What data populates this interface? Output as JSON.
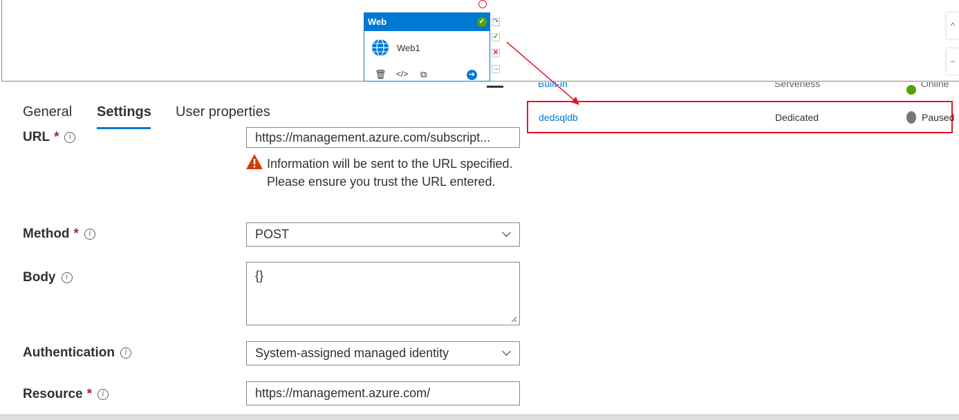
{
  "activity": {
    "type_label": "Web",
    "name": "Web1",
    "tools": {
      "delete": "🗑",
      "code": "</>",
      "copy": "⧉",
      "go": "➔"
    }
  },
  "side_buttons": {
    "rerun": "↷",
    "success": "✓",
    "fail": "✕",
    "next": "→"
  },
  "pool_list": {
    "partial_row": {
      "name": "Built-in",
      "type": "Serverless",
      "status": "Online"
    },
    "highlighted_row": {
      "name": "dedsqldb",
      "type": "Dedicated",
      "status": "Paused"
    }
  },
  "tabs": [
    "General",
    "Settings",
    "User properties"
  ],
  "form": {
    "url": {
      "label": "URL",
      "value": "https://management.azure.com/subscript..."
    },
    "warning": "Information will be sent to the URL specified. Please ensure you trust the URL entered.",
    "method": {
      "label": "Method",
      "value": "POST"
    },
    "body": {
      "label": "Body",
      "value": "{}"
    },
    "authentication": {
      "label": "Authentication",
      "value": "System-assigned managed identity"
    },
    "resource": {
      "label": "Resource",
      "value": "https://management.azure.com/"
    }
  },
  "required_mark": "*",
  "info_mark": "i",
  "zoom": {
    "up": "^",
    "minus": "−"
  },
  "colors": {
    "accent": "#0078d4",
    "highlight": "#e81123",
    "success": "#57a300",
    "warning": "#d83b01"
  }
}
